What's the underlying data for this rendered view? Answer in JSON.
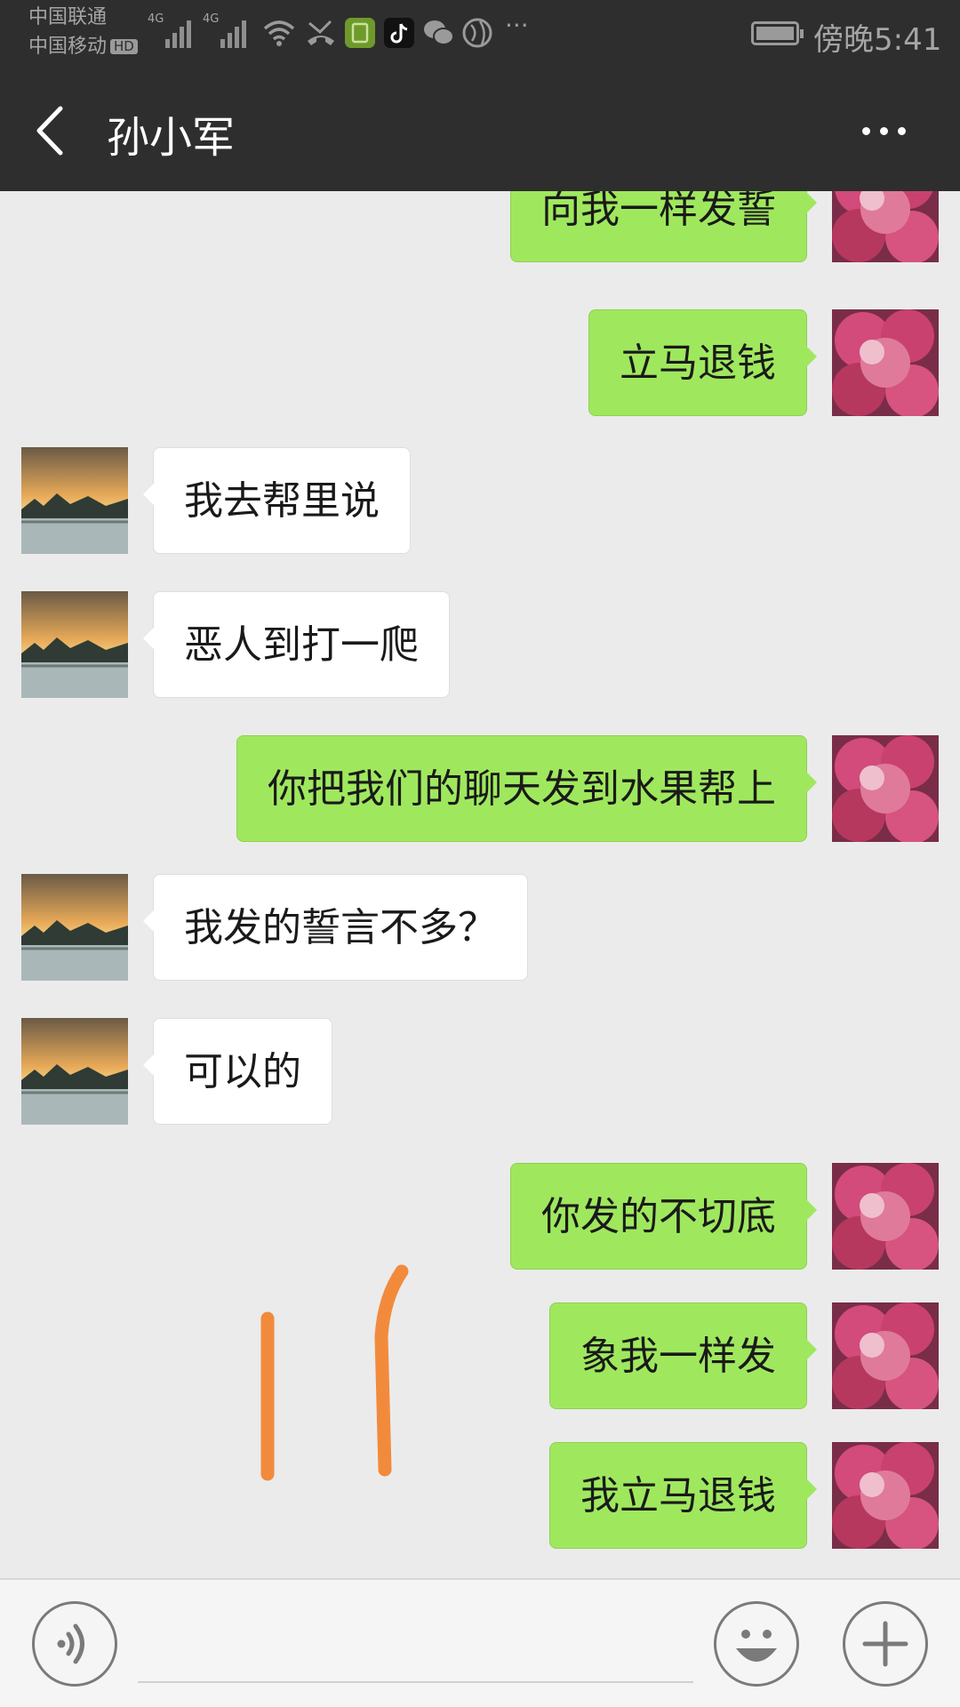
{
  "status_bar": {
    "carrier_1": "中国联通",
    "carrier_2": "中国移动",
    "hd_badge": "HD",
    "network_1": "4G",
    "network_2": "4G",
    "time": "傍晚5:41",
    "icons": [
      "signal-icon",
      "signal-icon",
      "wifi-icon",
      "missed-call-icon",
      "app-icon",
      "tiktok-icon",
      "wechat-icon",
      "browser-icon",
      "more-notifications-icon",
      "battery-icon"
    ],
    "more_dots": "···"
  },
  "header": {
    "title": "孙小军",
    "back_icon": "back-arrow-icon",
    "more_icon": "more-icon"
  },
  "messages": [
    {
      "side": "out",
      "text": "向我一样发誓"
    },
    {
      "side": "out",
      "text": "立马退钱"
    },
    {
      "side": "in",
      "text": "我去帮里说"
    },
    {
      "side": "in",
      "text": "恶人到打一爬"
    },
    {
      "side": "out",
      "text": "你把我们的聊天发到水果帮上"
    },
    {
      "side": "in",
      "text": "我发的誓言不多？"
    },
    {
      "side": "in",
      "text": "可以的"
    },
    {
      "side": "out",
      "text": "你发的不切底"
    },
    {
      "side": "out",
      "text": "象我一样发"
    },
    {
      "side": "out",
      "text": "我立马退钱"
    }
  ],
  "input_bar": {
    "message_value": "",
    "voice_icon": "voice-icon",
    "emoji_icon": "emoji-icon",
    "plus_icon": "plus-icon"
  },
  "colors": {
    "header_bg": "#2e2e2e",
    "chat_bg": "#ebebeb",
    "out_bubble": "#9fe85e",
    "in_bubble": "#ffffff",
    "annotation": "#f28a3c"
  }
}
